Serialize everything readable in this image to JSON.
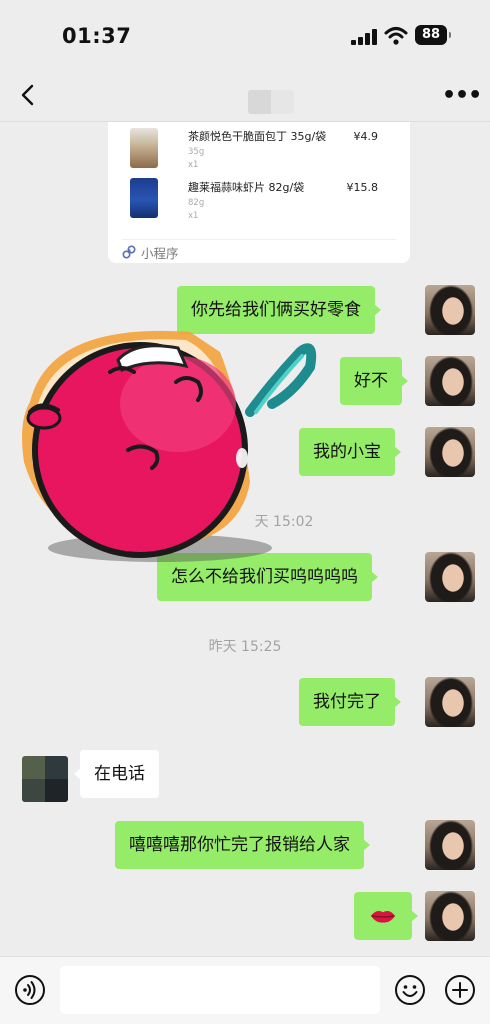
{
  "status_bar": {
    "time": "01:37",
    "battery": "88"
  },
  "nav": {
    "back_icon": "chevron-left-icon",
    "more_icon": "more-dots-icon",
    "more_label": "•••"
  },
  "mini_program": {
    "products": [
      {
        "name": "茶颜悦色干脆面包丁 35g/袋",
        "weight": "35g",
        "qty": "x1",
        "price": "¥4.9"
      },
      {
        "name": "趣莱福蒜味虾片 82g/袋",
        "weight": "82g",
        "qty": "x1",
        "price": "¥15.8"
      }
    ],
    "footer_label": "小程序"
  },
  "messages": {
    "m1": "你先给我们俩买好零食",
    "m2": "好不",
    "m3": "我的小宝",
    "time1": "天 15:02",
    "m4": "怎么不给我们买呜呜呜呜",
    "time2": "昨天 15:25",
    "m5": "我付完了",
    "m6": "在电话",
    "m7": "嘻嘻嘻那你忙完了报销给人家",
    "m8_icon": "lips-emoji"
  },
  "input_bar": {
    "voice_icon": "voice-icon",
    "emoji_icon": "emoji-icon",
    "plus_icon": "plus-icon"
  },
  "colors": {
    "bubble_out": "#95ec69",
    "bubble_in": "#ffffff",
    "background": "#ededed"
  }
}
